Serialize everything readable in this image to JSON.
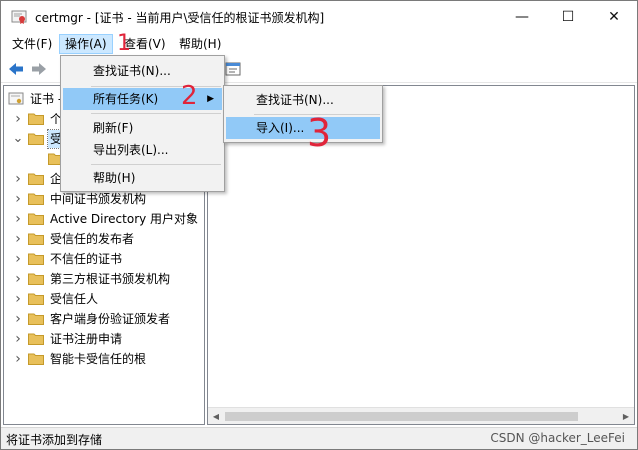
{
  "window": {
    "title": "certmgr - [证书 - 当前用户\\受信任的根证书颁发机构]",
    "minimize_glyph": "—",
    "maximize_glyph": "☐",
    "close_glyph": "✕"
  },
  "menubar": {
    "items": [
      "文件(F)",
      "操作(A)",
      "查看(V)",
      "帮助(H)"
    ]
  },
  "tree": {
    "root": "证书 -",
    "items": [
      {
        "label": "个",
        "expand": "collapsed"
      },
      {
        "label": "受",
        "expand": "expanded"
      },
      {
        "label": "",
        "expand": "none"
      },
      {
        "label": "企",
        "expand": "collapsed"
      },
      {
        "label": "中间证书颁发机构",
        "expand": "collapsed"
      },
      {
        "label": "Active Directory 用户对象",
        "expand": "collapsed"
      },
      {
        "label": "受信任的发布者",
        "expand": "collapsed"
      },
      {
        "label": "不信任的证书",
        "expand": "collapsed"
      },
      {
        "label": "第三方根证书颁发机构",
        "expand": "collapsed"
      },
      {
        "label": "受信任人",
        "expand": "collapsed"
      },
      {
        "label": "客户端身份验证颁发者",
        "expand": "collapsed"
      },
      {
        "label": "证书注册申请",
        "expand": "collapsed"
      },
      {
        "label": "智能卡受信任的根",
        "expand": "collapsed"
      }
    ]
  },
  "action_menu": {
    "items": [
      "查找证书(N)...",
      "所有任务(K)",
      "刷新(F)",
      "导出列表(L)...",
      "帮助(H)"
    ]
  },
  "submenu": {
    "items": [
      "查找证书(N)...",
      "导入(I)..."
    ]
  },
  "status": {
    "text": "将证书添加到存储",
    "watermark": "CSDN @hacker_LeeFei"
  },
  "annotations": [
    "1",
    "2",
    "3"
  ],
  "colors": {
    "highlight": "#91c9f7",
    "menu_active": "#cce8ff",
    "annotation": "#e0243a",
    "folder": "#e8c05a"
  }
}
